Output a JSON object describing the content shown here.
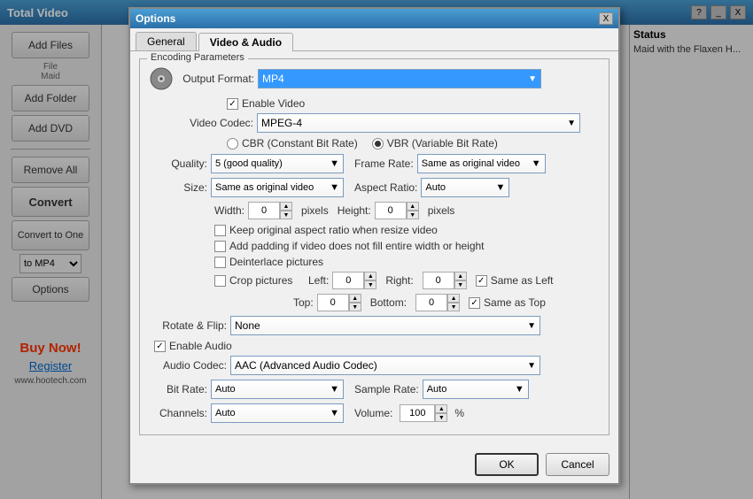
{
  "app": {
    "title": "Total Video",
    "title_bar_buttons": [
      "?",
      "_",
      "X"
    ]
  },
  "sidebar": {
    "add_files_label": "Add Files",
    "file_maid_label": "File\nMaid",
    "add_folder_label": "Add Folder",
    "add_dvd_label": "Add DVD",
    "remove_all_label": "Remove All",
    "convert_label": "Convert",
    "convert_to_one_label": "Convert to One",
    "format_label": "to MP4",
    "options_label": "Options",
    "buy_now_label": "Buy Now!",
    "register_label": "Register",
    "website_label": "www.hootech.com"
  },
  "status": {
    "label": "Status",
    "text": "Maid with the Flaxen H..."
  },
  "dialog": {
    "title": "Options",
    "close_btn": "X",
    "tabs": [
      {
        "label": "General",
        "active": false
      },
      {
        "label": "Video & Audio",
        "active": true
      }
    ],
    "encoding_group_title": "Encoding Parameters",
    "output_format_label": "Output Format:",
    "output_format_value": "MP4",
    "enable_video_label": "Enable Video",
    "video_codec_label": "Video Codec:",
    "video_codec_value": "MPEG-4",
    "cbr_label": "CBR (Constant Bit Rate)",
    "vbr_label": "VBR (Variable Bit Rate)",
    "quality_label": "Quality:",
    "quality_value": "5 (good quality)",
    "framerate_label": "Frame Rate:",
    "framerate_value": "Same as original video",
    "size_label": "Size:",
    "size_value": "Same as original video",
    "aspect_ratio_label": "Aspect Ratio:",
    "aspect_ratio_value": "Auto",
    "width_label": "Width:",
    "width_value": "0",
    "pixels_label1": "pixels",
    "height_label": "Height:",
    "height_value": "0",
    "pixels_label2": "pixels",
    "keep_ratio_label": "Keep original aspect ratio when resize video",
    "add_padding_label": "Add padding if video does not fill entire width or height",
    "deinterlace_label": "Deinterlace pictures",
    "crop_pictures_label": "Crop pictures",
    "left_label": "Left:",
    "left_value": "0",
    "right_label": "Right:",
    "right_value": "0",
    "same_as_left_label": "Same as Left",
    "top_label": "Top:",
    "top_value": "0",
    "bottom_label": "Bottom:",
    "bottom_value": "0",
    "same_as_top_label": "Same as Top",
    "rotate_flip_label": "Rotate & Flip:",
    "rotate_flip_value": "None",
    "enable_audio_label": "Enable Audio",
    "audio_codec_label": "Audio Codec:",
    "audio_codec_value": "AAC (Advanced Audio Codec)",
    "bit_rate_label": "Bit Rate:",
    "bit_rate_value": "Auto",
    "sample_rate_label": "Sample Rate:",
    "sample_rate_value": "Auto",
    "channels_label": "Channels:",
    "channels_value": "Auto",
    "volume_label": "Volume:",
    "volume_value": "100",
    "percent_label": "%",
    "ok_label": "OK",
    "cancel_label": "Cancel"
  }
}
